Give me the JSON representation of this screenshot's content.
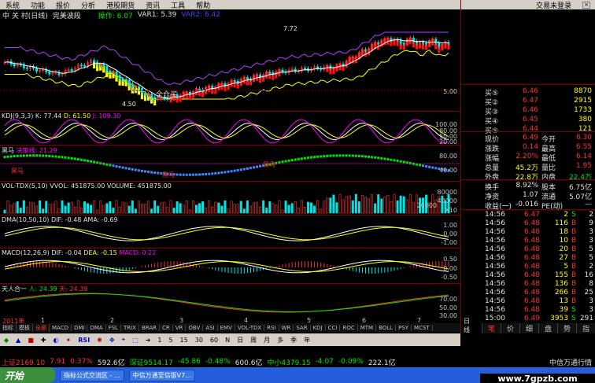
{
  "menu": {
    "items": [
      "系统",
      "功能",
      "报价",
      "分析",
      "港股期货",
      "资讯",
      "工具",
      "帮助"
    ],
    "status": "交易未登录"
  },
  "title": {
    "stock": "中 关 村(日线)",
    "indicator": "完美波段",
    "op_label": "操作: 6.07",
    "var1": "VAR1: 5.39",
    "var2": "VAR2: 6.42"
  },
  "main_chart": {
    "annotations": {
      "high": "7.72",
      "low": "4.50",
      "signal": "全仓买"
    },
    "axis": [
      "5.00"
    ]
  },
  "panels": {
    "kdj": {
      "label": "KDJ(9,3,3)",
      "k": "K: 77.44",
      "d": "D: 61.50",
      "j": "J: 109.30",
      "axis": [
        "100.00",
        "80.00",
        "50.00",
        "20.00"
      ]
    },
    "heima": {
      "label": "黑马",
      "line": "决策线: 21.29",
      "tag1": "黑马",
      "tag2": "黑马",
      "tag3": "黑马",
      "axis": [
        "80.00",
        "40.00"
      ]
    },
    "vol": {
      "label": "VOL-TDX(5,10)",
      "vvol": "VVOL: 451875.00",
      "volume": "VOLUME: 451875.00",
      "axis": [
        "80000",
        "40000",
        "20000"
      ],
      "unit": "X10"
    },
    "dma": {
      "label": "DMA(10,50,10)",
      "dif": "DIF: -0.48",
      "ama": "AMA: -0.69",
      "axis": [
        "1.00",
        "0.00",
        "-1.00"
      ]
    },
    "macd": {
      "label": "MACD(12,26,9)",
      "dif": "DIF: -0.04",
      "dea": "DEA: -0.15",
      "macd": "MACD: 0.22",
      "axis": [
        "0.50",
        "0.00",
        "-0.50"
      ]
    },
    "trhy": {
      "label": "天人合一",
      "ren": "人: 24.39",
      "tian": "天: 24.39",
      "axis": [
        "70.00",
        "50.00",
        "30.00"
      ]
    }
  },
  "time_axis": {
    "year": "2011年",
    "months": [
      "1",
      "2",
      "3",
      "4",
      "5",
      "6",
      "7"
    ],
    "period": "日线"
  },
  "right_panel": {
    "asks": [
      {
        "label": "买⑤",
        "price": "6.46",
        "vol": "8870"
      },
      {
        "label": "买②",
        "price": "6.47",
        "vol": "2915"
      },
      {
        "label": "买③",
        "price": "6.46",
        "vol": "1733"
      },
      {
        "label": "买④",
        "price": "6.45",
        "vol": "380"
      },
      {
        "label": "买⑤",
        "price": "6.44",
        "vol": "121"
      }
    ],
    "stats": [
      {
        "l1": "现价",
        "v1": "6.49",
        "l2": "今开",
        "v2": "6.30"
      },
      {
        "l1": "涨跌",
        "v1": "0.14",
        "l2": "最高",
        "v2": "6.55"
      },
      {
        "l1": "涨幅",
        "v1": "2.20%",
        "l2": "最低",
        "v2": "6.14"
      },
      {
        "l1": "总量",
        "v1": "45.2万",
        "l2": "量比",
        "v2": "1.95"
      },
      {
        "l1": "外盘",
        "v1": "22.8万",
        "l2": "内盘",
        "v2": "22.4万"
      }
    ],
    "stats2": [
      {
        "l1": "换手",
        "v1": "8.92%",
        "l2": "股本",
        "v2": "6.75亿"
      },
      {
        "l1": "净资",
        "v1": "1.07",
        "l2": "流通",
        "v2": "5.07亿"
      },
      {
        "l1": "收益(一)",
        "v1": "-0.016",
        "l2": "PE(动)",
        "v2": "—"
      }
    ],
    "ticks": [
      {
        "time": "14:56",
        "price": "6.47",
        "vol": "2",
        "side": "S",
        "num": "2"
      },
      {
        "time": "14:56",
        "price": "6.48",
        "vol": "116",
        "side": "B",
        "num": "9"
      },
      {
        "time": "14:56",
        "price": "6.48",
        "vol": "18",
        "side": "B",
        "num": "3"
      },
      {
        "time": "14:56",
        "price": "6.48",
        "vol": "10",
        "side": "B",
        "num": "3"
      },
      {
        "time": "14:56",
        "price": "6.48",
        "vol": "20",
        "side": "B",
        "num": "5"
      },
      {
        "time": "14:56",
        "price": "6.48",
        "vol": "27",
        "side": "B",
        "num": "5"
      },
      {
        "time": "14:56",
        "price": "6.48",
        "vol": "5",
        "side": "B",
        "num": "2"
      },
      {
        "time": "14:56",
        "price": "6.48",
        "vol": "155",
        "side": "B",
        "num": "16"
      },
      {
        "time": "14:56",
        "price": "6.48",
        "vol": "136",
        "side": "B",
        "num": "8"
      },
      {
        "time": "14:56",
        "price": "6.48",
        "vol": "266",
        "side": "B",
        "num": "25"
      },
      {
        "time": "14:56",
        "price": "6.48",
        "vol": "13",
        "side": "B",
        "num": "3"
      },
      {
        "time": "14:56",
        "price": "6.48",
        "vol": "39",
        "side": "S",
        "num": "3"
      },
      {
        "time": "15:00",
        "price": "6.49",
        "vol": "3953",
        "side": "S",
        "num": "291"
      }
    ],
    "tabs": [
      "笔",
      "价",
      "细",
      "盘",
      "势",
      "指"
    ]
  },
  "bottom_tabs": [
    "指标",
    "模板",
    "全部",
    "MACD",
    "DMI",
    "DMA",
    "FSL",
    "TRIX",
    "BRAR",
    "CR",
    "VR",
    "OBV",
    "ASI",
    "EMV",
    "VOL-TDX",
    "RSI",
    "WR",
    "SAR",
    "KDJ",
    "CCI",
    "ROC",
    "MTM",
    "BOLL",
    "PSY",
    "MCST"
  ],
  "toolbar": [
    "RSI",
    "1",
    "5",
    "15",
    "30",
    "60",
    "N",
    "日",
    "周",
    "月",
    "多",
    "季",
    "年"
  ],
  "statusbar": {
    "sh": "上证2169.10",
    "sh_chg": "7.91",
    "sh_pct": "0.37%",
    "sh_amt": "592.6亿",
    "sz": "深证9514.17",
    "sz_chg": "-45.86",
    "sz_pct": "-0.48%",
    "sz_amt": "600.6亿",
    "zx": "中小4379.15",
    "zx_chg": "-4.07",
    "zx_pct": "-0.09%",
    "zx_amt": "222.1亿",
    "broker": "中信万通行情"
  },
  "taskbar": {
    "start": "开始",
    "tasks": [
      "指标公式交流区 - ...",
      "中信万通至信版V7..."
    ]
  },
  "watermark": "www.7gpzb.com"
}
